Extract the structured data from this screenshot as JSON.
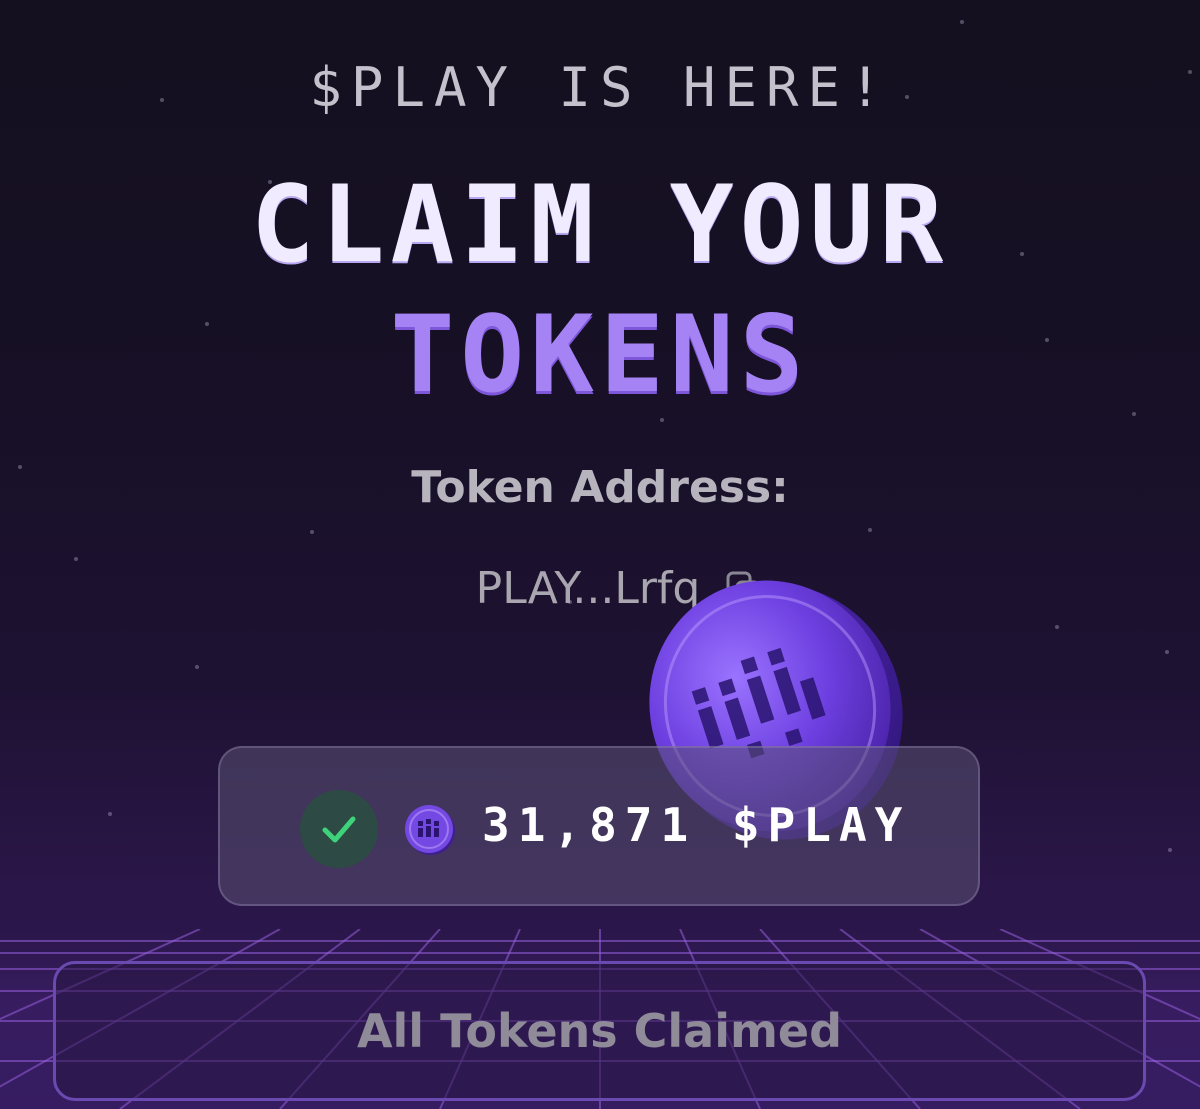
{
  "header": {
    "eyebrow": "$PLAY IS HERE!",
    "title_line_1": "CLAIM YOUR",
    "title_line_2": "TOKENS"
  },
  "token": {
    "address_label": "Token Address:",
    "address_short": "PLAY...Lrfq",
    "copy_icon": "copy-icon",
    "coin_icon": "play-coin-icon"
  },
  "balance": {
    "status_icon": "check-icon",
    "amount_text": "31,871 $PLAY"
  },
  "actions": {
    "claim_button_label": "All Tokens Claimed"
  },
  "colors": {
    "accent_purple": "#a683f4",
    "check_green": "#3ed37a",
    "button_border": "#6a49b0"
  }
}
